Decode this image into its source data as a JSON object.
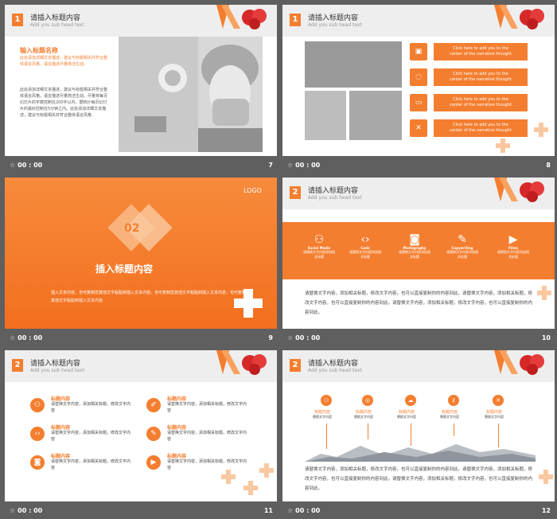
{
  "header": {
    "title": "请插入标题内容",
    "subtitle": "Add you sub head text",
    "number1": "1",
    "number2": "2"
  },
  "footer": {
    "time": "00 : 00",
    "star": "☆"
  },
  "pages": [
    "7",
    "8",
    "9",
    "10",
    "11",
    "12"
  ],
  "s7": {
    "heading": "输入标题名称",
    "orange": "此处添加详细文本描述，建议与标题相关并符合整体语言风格，语言描述尽量简洁生动。",
    "body": "此处添加详细文本描述，建议与标题相关并符合整体语言风格，语言描述尽量简洁生动。尽量将每页幻灯片的字数控制在200字以内，据统计每页幻灯片的最好控制在5分钟之内。此处添加详细文本描述，建议与标题相关并符合整体语言风格"
  },
  "s8": {
    "click": [
      "Click here to add you to the",
      "center of the narrative thought"
    ]
  },
  "s9": {
    "logo": "LOGO",
    "num": "02",
    "title": "插入标题内容",
    "text": "插入文本内容，也可复制您其他文字粘贴到插入文本内容，也可复制您其他文字粘贴到插入文本内容，也可复制您其他文字粘贴到插入文本内容"
  },
  "s10": {
    "icons": [
      {
        "name": "Social Media"
      },
      {
        "name": "Code"
      },
      {
        "name": "Photography"
      },
      {
        "name": "Copywriting"
      },
      {
        "name": "Films"
      }
    ],
    "itext": "请替换文字内容添加相关标题",
    "body": "请替换文字内容，添加相关标题，修改文字内容，也可以直接复制你的内容到此。请替换文字内容，添加相关标题，修改文字内容，也可以直接复制你的内容到此。请替换文字内容，添加相关标题，修改文字内容，也可以直接复制你的内容到此。"
  },
  "s11": {
    "label": "标题内容",
    "desc": "请替换文字内容，添加相关标题，修改文字内容"
  },
  "s12": {
    "label": "标题内容",
    "desc": "替换文字内容",
    "body": "请替换文字内容，添加相关标题，修改文字内容，也可以直接复制你的内容到此。请替换文字内容，添加相关标题，修改文字内容，也可以直接复制你的内容到此。请替换文字内容，添加相关标题，修改文字内容，也可以直接复制你的内容到此。"
  },
  "colors": {
    "accent": "#f47e2f",
    "bg": "#5f5f5f"
  }
}
